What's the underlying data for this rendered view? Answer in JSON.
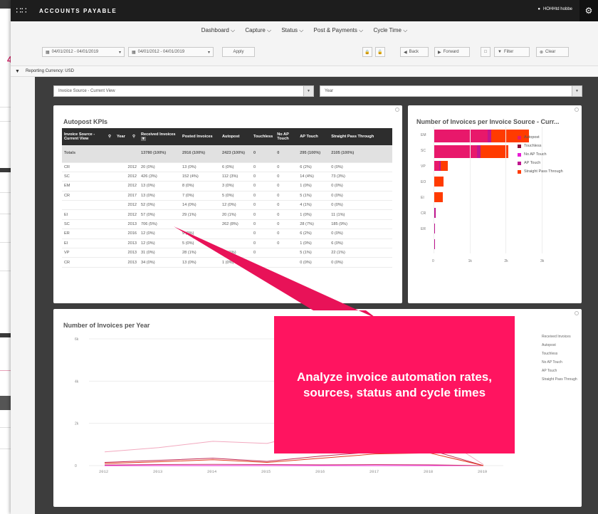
{
  "app": {
    "title": "ACCOUNTS PAYABLE",
    "user": "HOHHtd hobbe"
  },
  "background_window": {
    "number": "4"
  },
  "nav": [
    "Dashboard ⌵",
    "Capture ⌵",
    "Status ⌵",
    "Post & Payments ⌵",
    "Cycle Time ⌵"
  ],
  "toolbar": {
    "date_range_1": "04/01/2012 - 04/01/2019",
    "date_range_2": "04/01/2012 - 04/01/2019",
    "apply": "Apply",
    "back": "Back",
    "forward": "Forward",
    "filter": "Filter",
    "clear": "Clear"
  },
  "reporting_currency": "Reporting Currency: USD",
  "selects": {
    "source": "Invoice Source - Current View",
    "year": "Year"
  },
  "kpi_panel": {
    "title": "Autopost KPIs",
    "columns": [
      "Invoice Source - Current View",
      "Year",
      "Received Invoices",
      "Posted Invoices",
      "Autopost",
      "Touchless",
      "No AP Touch",
      "AP Touch",
      "Straight Pass Through"
    ],
    "totals": [
      "Totals",
      "",
      "13780 (100%)",
      "2916 (100%)",
      "2423 (100%)",
      "0",
      "0",
      "295 (100%)",
      "2105 (100%)"
    ],
    "rows": [
      [
        "CR",
        "2012",
        "20 (0%)",
        "13 (0%)",
        "6 (0%)",
        "0",
        "0",
        "6 (2%)",
        "0 (0%)"
      ],
      [
        "SC",
        "2012",
        "426 (3%)",
        "152 (4%)",
        "112 (3%)",
        "0",
        "0",
        "14 (4%)",
        "73 (3%)"
      ],
      [
        "EM",
        "2012",
        "13 (0%)",
        "8 (0%)",
        "3 (0%)",
        "0",
        "0",
        "1 (0%)",
        "0 (0%)"
      ],
      [
        "CR",
        "2017",
        "13 (0%)",
        "7 (0%)",
        "5 (0%)",
        "0",
        "0",
        "5 (1%)",
        "0 (0%)"
      ],
      [
        "",
        "2012",
        "52 (0%)",
        "14 (0%)",
        "12 (0%)",
        "0",
        "0",
        "4 (1%)",
        "0 (0%)"
      ],
      [
        "EI",
        "2012",
        "57 (0%)",
        "29 (1%)",
        "20 (1%)",
        "0",
        "0",
        "1 (0%)",
        "11 (1%)"
      ],
      [
        "SC",
        "2013",
        "706 (5%)",
        "",
        "262 (8%)",
        "0",
        "0",
        "28 (7%)",
        "185 (9%)"
      ],
      [
        "ER",
        "2016",
        "12 (0%)",
        "9 (0%)",
        "",
        "0",
        "0",
        "6 (2%)",
        "0 (0%)"
      ],
      [
        "EI",
        "2013",
        "12 (0%)",
        "5 (0%)",
        "",
        "0",
        "0",
        "1 (0%)",
        "6 (0%)"
      ],
      [
        "VP",
        "2013",
        "31 (0%)",
        "28 (1%)",
        "27 (1%)",
        "0",
        "",
        "5 (1%)",
        "22 (1%)"
      ],
      [
        "CR",
        "2013",
        "34 (0%)",
        "13 (0%)",
        "1 (0%)",
        "",
        "",
        "0 (0%)",
        "0 (0%)"
      ]
    ]
  },
  "source_chart": {
    "title": "Number of Invoices per Invoice Source - Curr...",
    "legend": [
      "Autopost",
      "Touchless",
      "No AP Touch",
      "AP Touch",
      "Straight Pass Through"
    ],
    "colors": [
      "#e8186b",
      "#8b0f3a",
      "#e81bd6",
      "#c0168f",
      "#ff3b00"
    ]
  },
  "year_chart": {
    "title": "Number of Invoices per Year",
    "legend": [
      "Received Invoices",
      "Autopost",
      "Touchless",
      "No AP Touch",
      "AP Touch",
      "Straight Pass Through"
    ]
  },
  "callout": "Analyze invoice automation rates, sources, status and cycle times",
  "chart_data": [
    {
      "type": "bar",
      "orientation": "horizontal",
      "stacked": true,
      "title": "Number of Invoices per Invoice Source - Curr...",
      "categories": [
        "EM",
        "SC",
        "VP",
        "EO",
        "EI",
        "CR",
        "ER",
        ""
      ],
      "xlim": [
        0,
        3000
      ],
      "xticks": [
        "0",
        "1k",
        "2k",
        "3k"
      ],
      "series": [
        {
          "name": "Autopost",
          "values": [
            1500,
            1200,
            150,
            0,
            0,
            0,
            0,
            0
          ]
        },
        {
          "name": "Touchless",
          "values": [
            0,
            0,
            0,
            0,
            0,
            0,
            0,
            0
          ]
        },
        {
          "name": "No AP Touch",
          "values": [
            0,
            0,
            0,
            0,
            0,
            0,
            0,
            0
          ]
        },
        {
          "name": "AP Touch",
          "values": [
            100,
            100,
            50,
            20,
            20,
            50,
            30,
            30
          ]
        },
        {
          "name": "Straight Pass Through",
          "values": [
            1050,
            780,
            200,
            250,
            230,
            0,
            0,
            0
          ]
        }
      ],
      "colors": [
        "#e8186b",
        "#8b0f3a",
        "#e81bd6",
        "#c0168f",
        "#ff3b00"
      ],
      "legend_position": "right"
    },
    {
      "type": "line",
      "title": "Number of Invoices per Year",
      "x": [
        "2012",
        "2013",
        "2014",
        "2015",
        "2016",
        "2017",
        "2018",
        "2019"
      ],
      "ylim": [
        0,
        6000
      ],
      "yticks": [
        "0",
        "2k",
        "4k",
        "6k"
      ],
      "series": [
        {
          "name": "Received Invoices",
          "values": [
            650,
            850,
            1150,
            1050,
            1650,
            1900,
            1700,
            50
          ]
        },
        {
          "name": "Autopost",
          "values": [
            150,
            250,
            350,
            200,
            450,
            650,
            750,
            0
          ]
        },
        {
          "name": "Touchless",
          "values": [
            0,
            0,
            0,
            0,
            0,
            0,
            0,
            0
          ]
        },
        {
          "name": "No AP Touch",
          "values": [
            0,
            0,
            0,
            0,
            0,
            0,
            0,
            0
          ]
        },
        {
          "name": "AP Touch",
          "values": [
            30,
            50,
            60,
            50,
            40,
            50,
            40,
            0
          ]
        },
        {
          "name": "Straight Pass Through",
          "values": [
            100,
            180,
            280,
            150,
            350,
            550,
            600,
            0
          ]
        }
      ],
      "colors": [
        "#f2a9bf",
        "#c42a55",
        "#8b0f3a",
        "#e81bd6",
        "#d04070",
        "#e23c1f"
      ],
      "legend_position": "right"
    }
  ]
}
